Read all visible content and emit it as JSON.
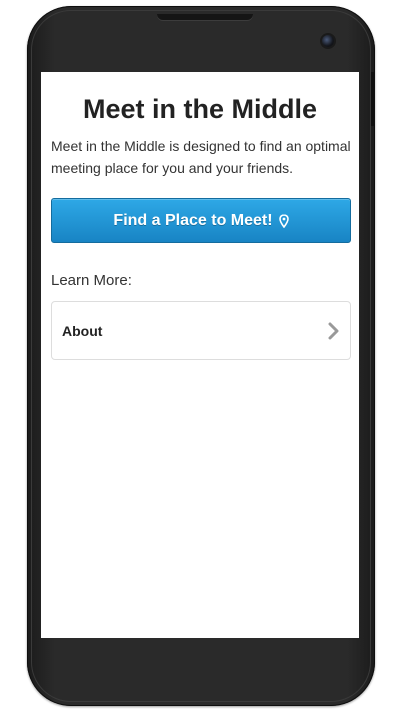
{
  "app": {
    "title": "Meet in the Middle",
    "description": "Meet in the Middle is designed to find an optimal meeting place for you and your friends."
  },
  "actions": {
    "find_label": "Find a Place to Meet!",
    "find_icon": "map-marker-icon"
  },
  "learn_more": {
    "heading": "Learn More:",
    "items": [
      {
        "label": "About",
        "icon": "chevron-right-icon"
      }
    ]
  },
  "colors": {
    "primary_button": "#1e95d4",
    "title_text": "#222222",
    "device_body": "#2a2a2a"
  }
}
